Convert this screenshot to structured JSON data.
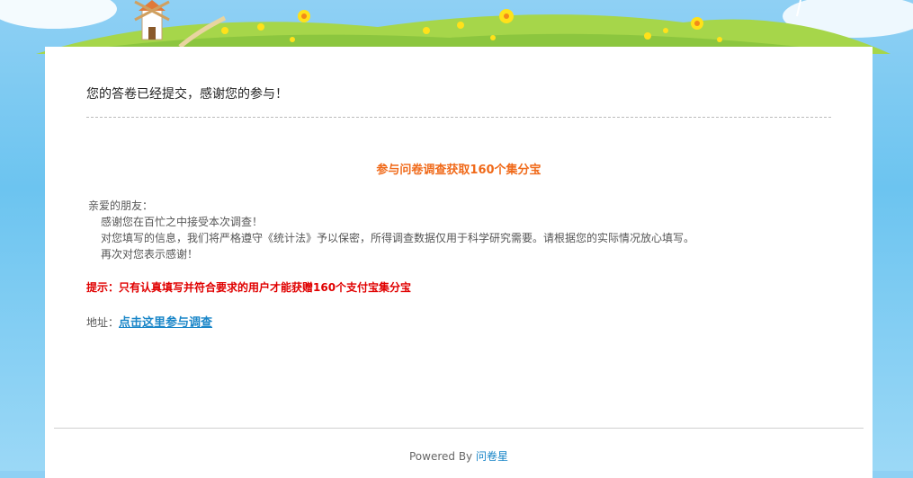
{
  "message": {
    "submitted_text": "您的答卷已经提交，感谢您的参与！"
  },
  "promo": {
    "title": "参与问卷调查获取160个集分宝",
    "greeting": "亲爱的朋友：",
    "lines": [
      "感谢您在百忙之中接受本次调查！",
      "对您填写的信息，我们将严格遵守《统计法》予以保密，所得调查数据仅用于科学研究需要。请根据您的实际情况放心填写。",
      "再次对您表示感谢！"
    ],
    "tip": "提示：只有认真填写并符合要求的用户才能获赠160个支付宝集分宝",
    "address_label": "地址：",
    "address_link": "点击这里参与调查"
  },
  "footer": {
    "powered_by": "Powered By",
    "brand": "问卷星"
  },
  "colors": {
    "title_orange": "#f06a1a",
    "tip_red": "#e00000",
    "link_blue": "#1a86c8",
    "grass_green": "#8cc63f",
    "sky_blue": "#8fd0f4"
  },
  "icons": [
    "windmill-icon",
    "flower-icon",
    "cloud-icon"
  ]
}
